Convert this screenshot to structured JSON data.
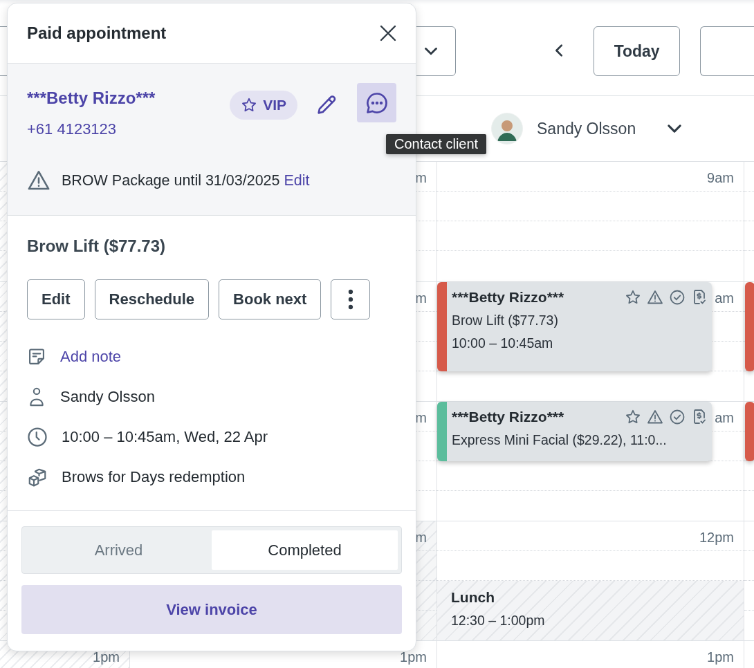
{
  "toolbar": {
    "today_button": "Today"
  },
  "staff_header": {
    "name": "Sandy Olsson"
  },
  "calendar": {
    "columns": [
      {
        "hour_labels": [
          "1pm"
        ]
      },
      {
        "hour_labels": [
          "m",
          "m",
          "m",
          "m",
          "1pm"
        ]
      },
      {
        "hour_labels": [
          "9am",
          "am",
          "am",
          "12pm",
          "1pm"
        ],
        "events": [
          {
            "kind": "appointment",
            "client": "***Betty Rizzo***",
            "lines": [
              "Brow Lift ($77.73)",
              "10:00 – 10:45am"
            ],
            "color": "#d65a4a"
          },
          {
            "kind": "appointment",
            "client": "***Betty Rizzo***",
            "lines": [
              "Express Mini Facial ($29.22), 11:0..."
            ],
            "color": "#5bbd9c"
          },
          {
            "kind": "break",
            "title": "Lunch",
            "time": "12:30 – 1:00pm"
          }
        ]
      },
      {
        "events": [
          {
            "kind": "appointment",
            "color": "#d65a4a"
          },
          {
            "kind": "appointment",
            "color": "#d65a4a"
          }
        ]
      }
    ]
  },
  "popover": {
    "title": "Paid appointment",
    "client": {
      "name": "***Betty Rizzo***",
      "phone": "+61 4123123",
      "vip_label": "VIP"
    },
    "alert": {
      "text": "BROW Package until 31/03/2025",
      "link": "Edit"
    },
    "service": "Brow Lift ($77.73)",
    "actions": [
      "Edit",
      "Reschedule",
      "Book next"
    ],
    "details": [
      {
        "kind": "note",
        "text": "Add note"
      },
      {
        "kind": "staff",
        "text": "Sandy Olsson"
      },
      {
        "kind": "time",
        "text": "10:00 – 10:45am, Wed, 22 Apr"
      },
      {
        "kind": "package",
        "text": "Brows for Days redemption"
      }
    ],
    "status": [
      {
        "label": "Arrived",
        "selected": false
      },
      {
        "label": "Completed",
        "selected": true
      }
    ],
    "invoice_button": "View invoice"
  },
  "tooltip": "Contact client"
}
